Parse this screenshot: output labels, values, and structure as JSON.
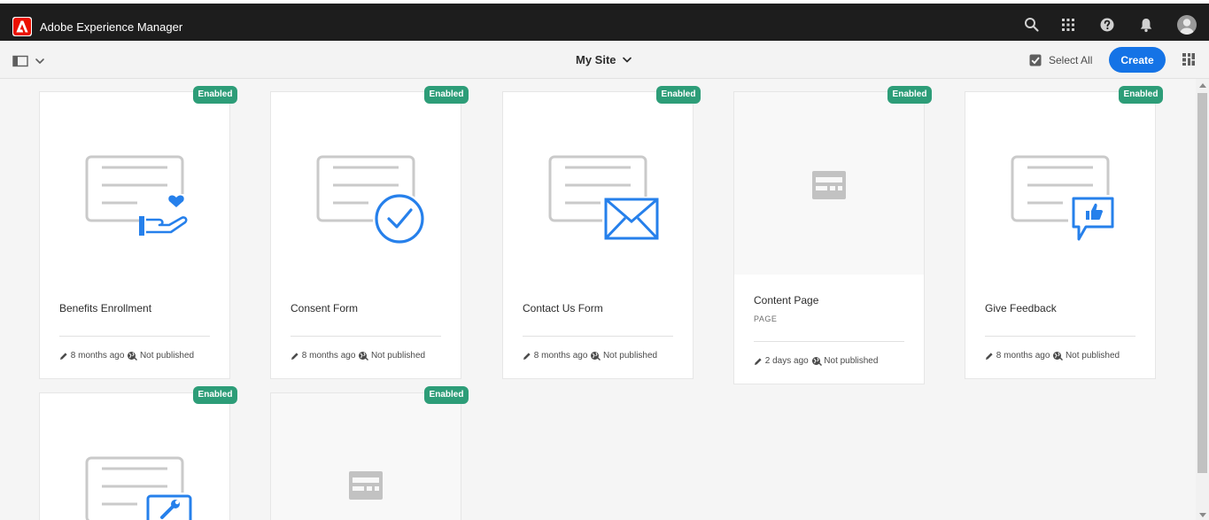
{
  "header": {
    "app_title": "Adobe Experience Manager",
    "icons": [
      "adobe-logo-icon",
      "search-icon",
      "apps-grid-icon",
      "help-icon",
      "notifications-bell-icon",
      "user-avatar-icon"
    ]
  },
  "actionbar": {
    "site_title": "My Site",
    "select_all_label": "Select All",
    "create_label": "Create"
  },
  "colors": {
    "header_bg": "#1d1d1d",
    "accent_blue": "#1473e6",
    "badge_green": "#2d9d78",
    "illustration_blue": "#2680eb",
    "illustration_grey": "#cacaca"
  },
  "cards": [
    {
      "title": "Benefits Enrollment",
      "badge": "Enabled",
      "modified": "8 months ago",
      "status": "Not published",
      "illustration": "form-heart-hand-icon"
    },
    {
      "title": "Consent Form",
      "badge": "Enabled",
      "modified": "8 months ago",
      "status": "Not published",
      "illustration": "form-checkmark-icon"
    },
    {
      "title": "Contact Us Form",
      "badge": "Enabled",
      "modified": "8 months ago",
      "status": "Not published",
      "illustration": "form-envelope-icon"
    },
    {
      "title": "Content Page",
      "subtitle": "PAGE",
      "badge": "Enabled",
      "modified": "2 days ago",
      "status": "Not published",
      "illustration": "page-template-icon"
    },
    {
      "title": "Give Feedback",
      "badge": "Enabled",
      "modified": "8 months ago",
      "status": "Not published",
      "illustration": "form-thumbs-up-icon"
    },
    {
      "badge": "Enabled",
      "illustration": "form-wrench-icon"
    },
    {
      "badge": "Enabled",
      "illustration": "page-template-icon"
    }
  ]
}
